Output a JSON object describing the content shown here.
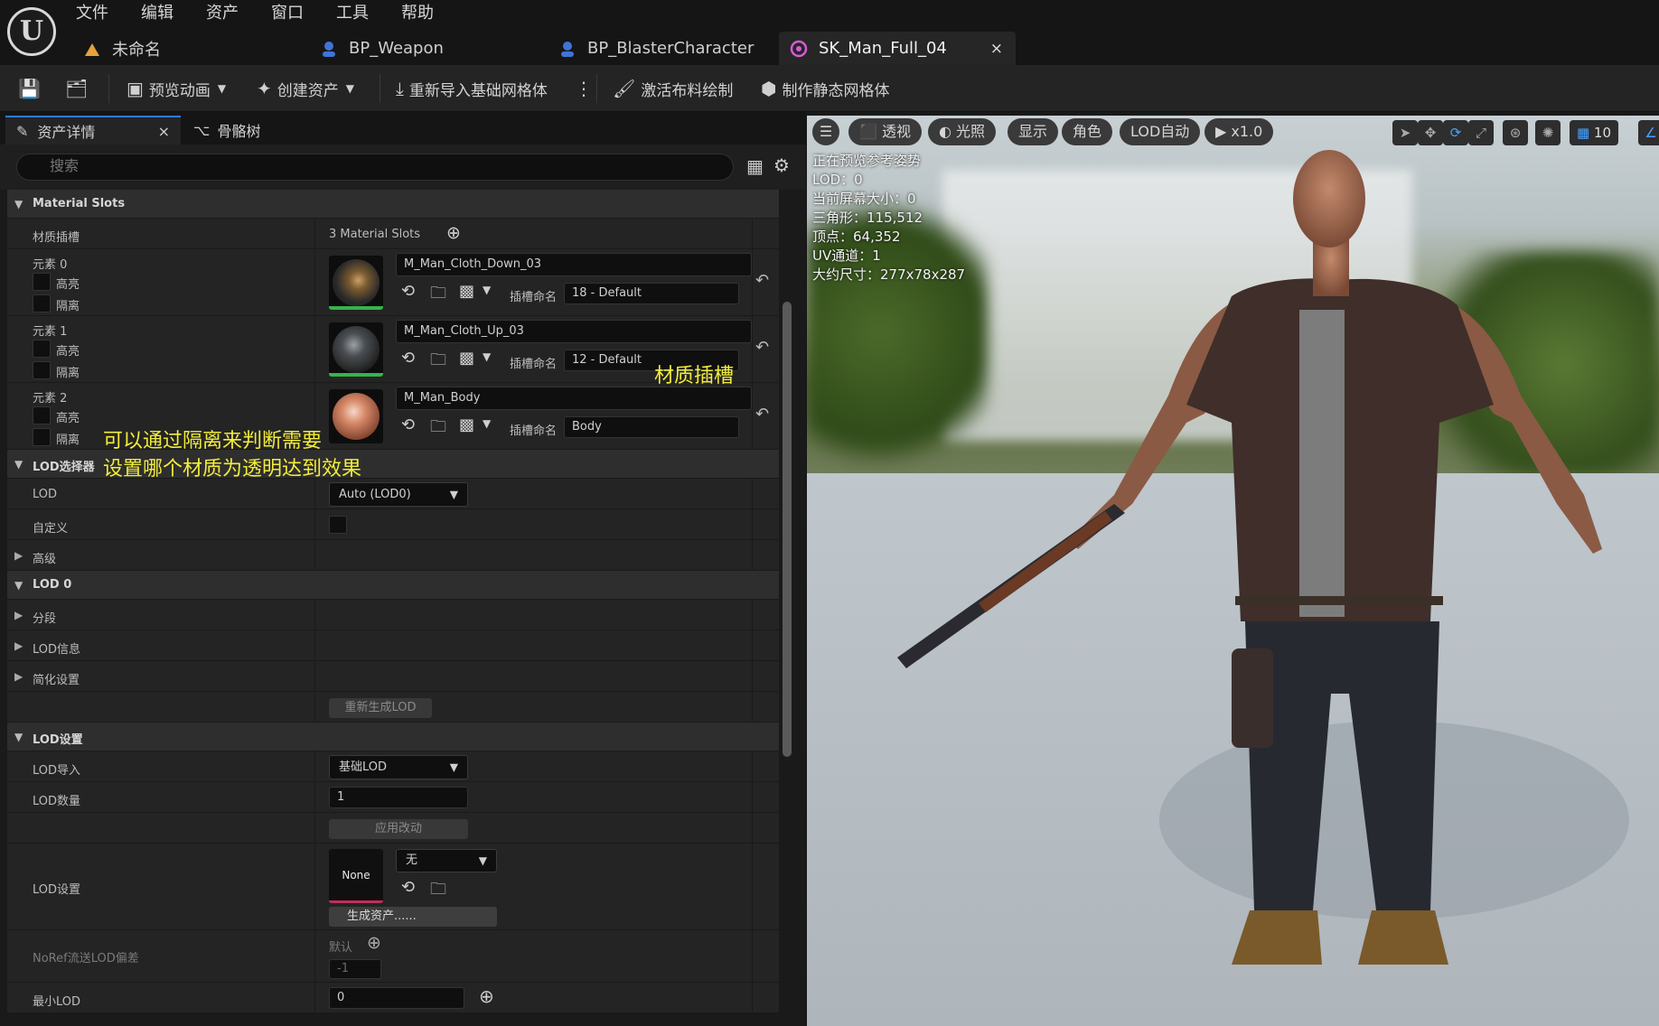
{
  "menu": [
    "文件",
    "编辑",
    "资产",
    "窗口",
    "工具",
    "帮助"
  ],
  "tabs": [
    {
      "label": "未命名"
    },
    {
      "label": "BP_Weapon"
    },
    {
      "label": "BP_BlasterCharacter"
    },
    {
      "label": "SK_Man_Full_04",
      "close": "×"
    }
  ],
  "toolbar": {
    "preview_anim": "预览动画",
    "create_asset": "创建资产",
    "reimport": "重新导入基础网格体",
    "cloth_paint": "激活布料绘制",
    "make_static": "制作静态网格体"
  },
  "panel_tabs": {
    "details": "资产详情",
    "skeleton": "骨骼树",
    "close": "×"
  },
  "search": {
    "placeholder": "搜索"
  },
  "material_slots": {
    "header": "Material Slots",
    "label": "材质插槽",
    "count": "3 Material Slots",
    "highlight": "高亮",
    "isolate": "隔离",
    "slot_name_label": "插槽命名",
    "elements": [
      {
        "label": "元素 0",
        "material": "M_Man_Cloth_Down_03",
        "slot": "18 - Default"
      },
      {
        "label": "元素 1",
        "material": "M_Man_Cloth_Up_03",
        "slot": "12 - Default"
      },
      {
        "label": "元素 2",
        "material": "M_Man_Body",
        "slot": "Body"
      }
    ]
  },
  "lod_picker": {
    "header": "LOD选择器",
    "lod_label": "LOD",
    "lod_value": "Auto (LOD0)",
    "custom_label": "自定义",
    "advanced": "高级"
  },
  "lod0": {
    "header": "LOD 0",
    "sections": "分段",
    "info": "LOD信息",
    "reduction": "简化设置",
    "regen": "重新生成LOD"
  },
  "lod_settings": {
    "header": "LOD设置",
    "import_label": "LOD导入",
    "import_value": "基础LOD",
    "count_label": "LOD数量",
    "count_value": "1",
    "apply": "应用改动",
    "settings_label": "LOD设置",
    "none_thumb": "None",
    "none_value": "无",
    "generate": "生成资产......",
    "noref_label": "NoRef流送LOD偏差",
    "default_label": "默认",
    "noref_value": "-1",
    "min_label": "最小LOD",
    "min_value": "0"
  },
  "annotations": {
    "slot": "材质插槽",
    "isolate_line1": "可以通过隔离来判断需要",
    "isolate_line2": "设置哪个材质为透明达到效果"
  },
  "viewport": {
    "perspective": "透视",
    "lighting": "光照",
    "show": "显示",
    "character": "角色",
    "lod_auto": "LOD自动",
    "speed": "x1.0",
    "grid_value": "10",
    "info": [
      "正在预览参考姿势",
      "LOD：0",
      "当前屏幕大小：0",
      "三角形：115,512",
      "顶点：64,352",
      "UV通道：1",
      "大约尺寸：277x78x287"
    ]
  }
}
